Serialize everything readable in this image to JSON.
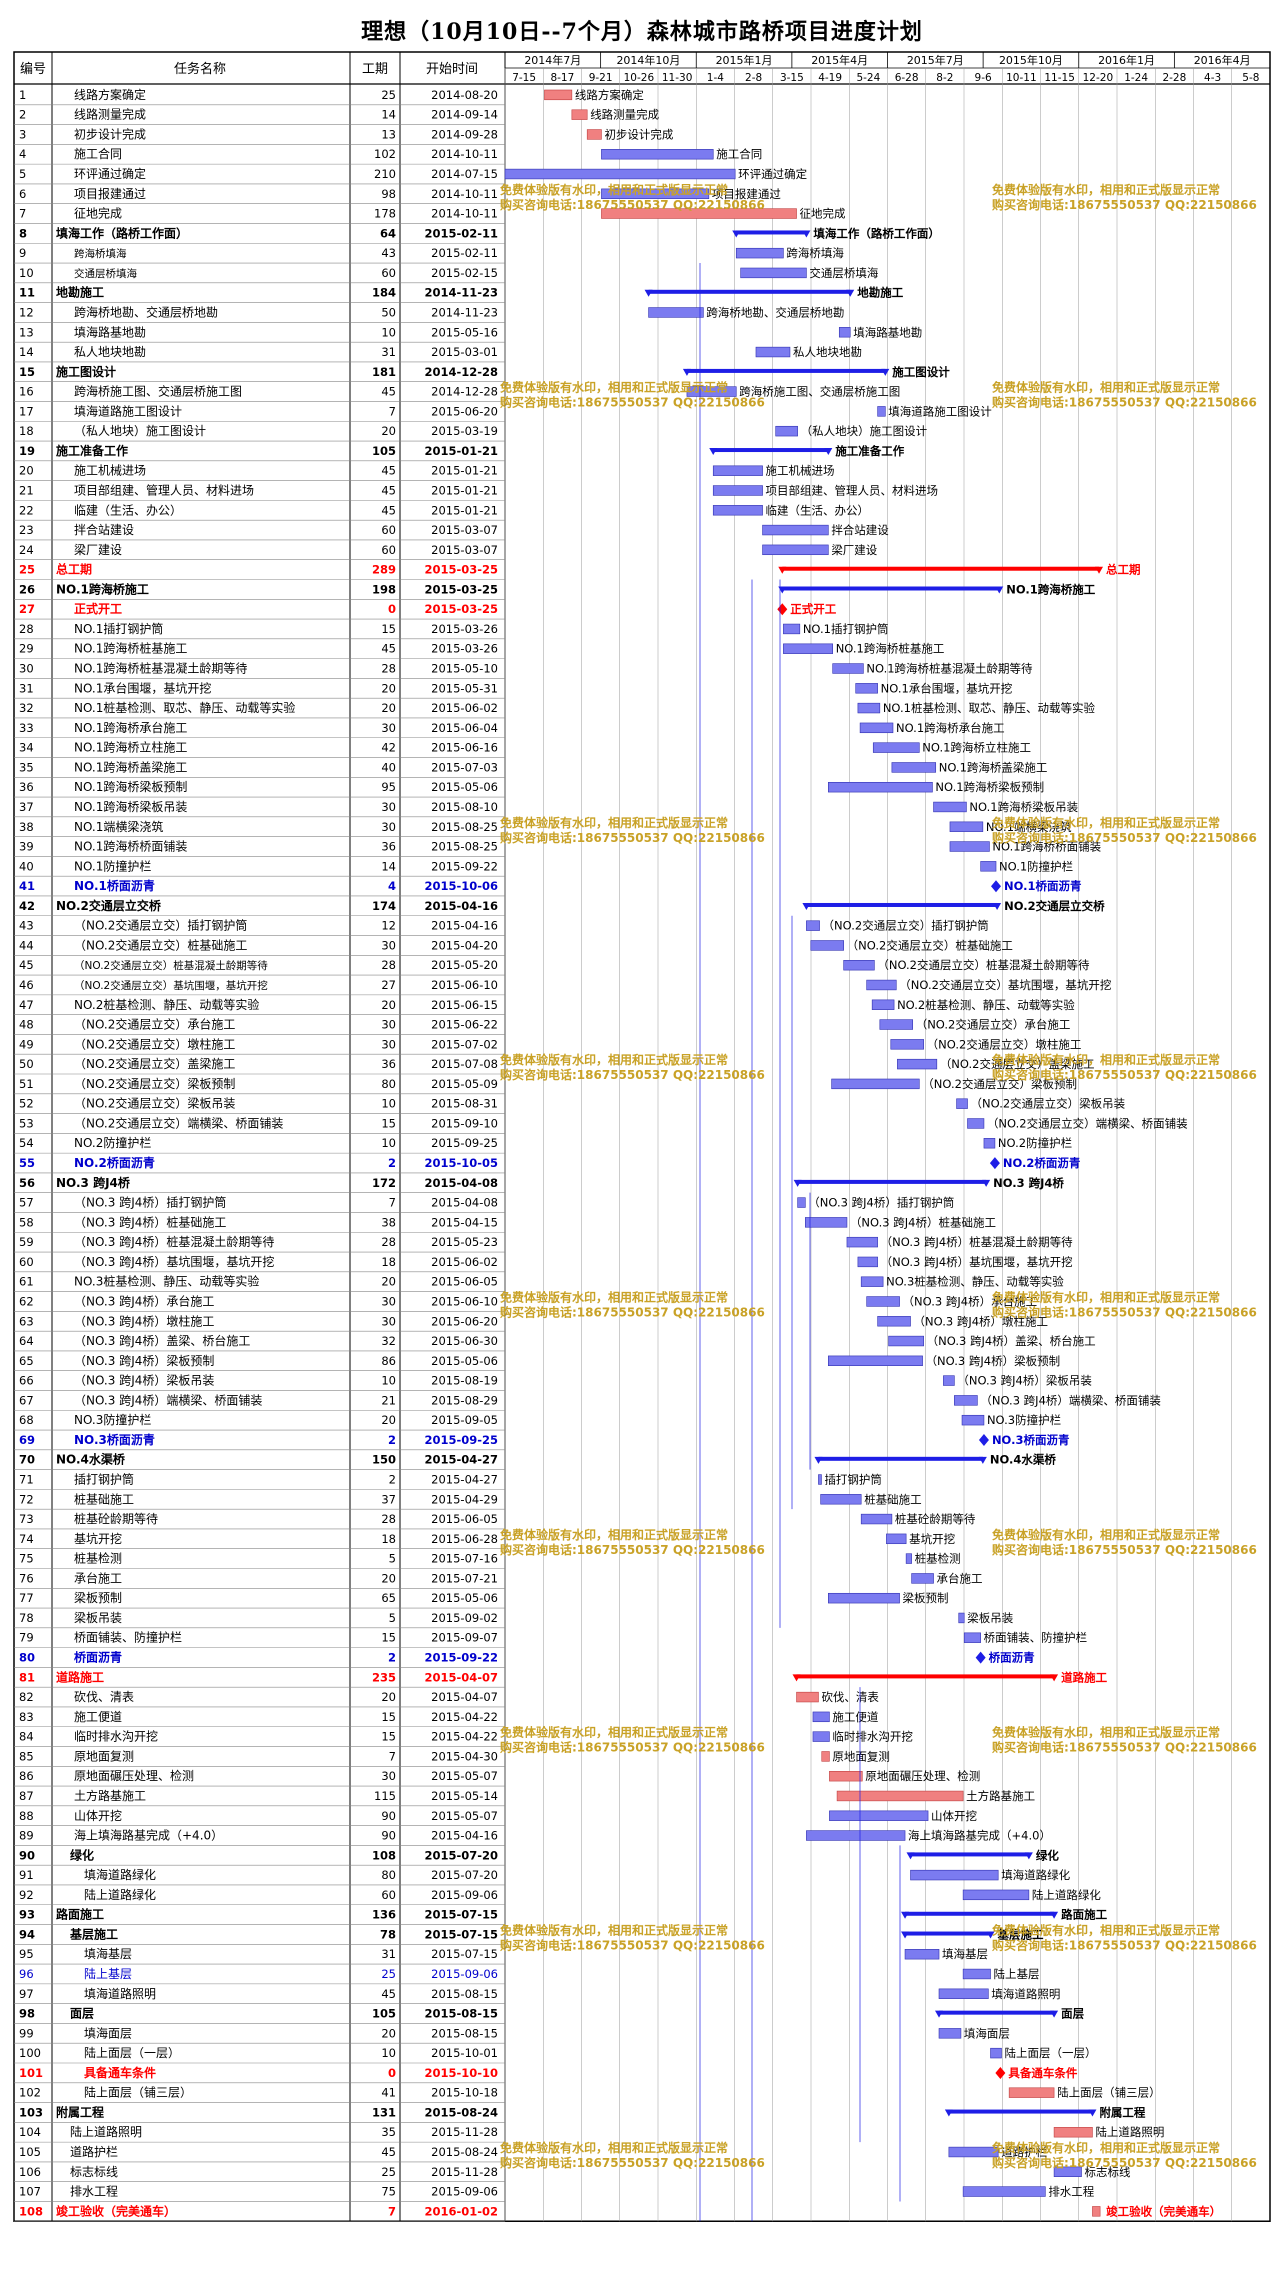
{
  "chart_data": {
    "type": "gantt",
    "title": "理想（10月10日--7个月）森林城市路桥项目进度计划",
    "columns": [
      "编号",
      "任务名称",
      "工期",
      "开始时间"
    ],
    "timeline_top": [
      "2014年7月",
      "2014年10月",
      "2015年1月",
      "2015年4月",
      "2015年7月",
      "2015年10月",
      "2016年1月",
      "2016年4月"
    ],
    "timeline_bottom": [
      "7-15",
      "8-17",
      "9-21",
      "10-26",
      "11-30",
      "1-4",
      "2-8",
      "3-15",
      "4-19",
      "5-24",
      "6-28",
      "8-2",
      "9-6",
      "10-11",
      "11-15",
      "12-20",
      "1-24",
      "2-28",
      "4-3",
      "5-8"
    ],
    "colors": {
      "task_bar": "#7b7bf0",
      "critical_bar": "#f08080",
      "summary": "#1e1ee6",
      "critical_summary": "#ff0000",
      "red_text": "#ff0000",
      "blue_text": "#0000cc",
      "watermark": "#c9a227",
      "grid": "#000000"
    },
    "watermark_lines": [
      "免费体验版有水印，相用和正式版显示正常",
      "购买咨询电话:18675550537 QQ:22150866"
    ],
    "tasks": [
      {
        "id": "1",
        "name": "线路方案确定",
        "dur": "25",
        "start": "2014-08-20",
        "type": "critical"
      },
      {
        "id": "2",
        "name": "线路测量完成",
        "dur": "14",
        "start": "2014-09-14",
        "type": "critical"
      },
      {
        "id": "3",
        "name": "初步设计完成",
        "dur": "13",
        "start": "2014-09-28",
        "type": "critical"
      },
      {
        "id": "4",
        "name": "施工合同",
        "dur": "102",
        "start": "2014-10-11",
        "type": "task"
      },
      {
        "id": "5",
        "name": "环评通过确定",
        "dur": "210",
        "start": "2014-07-15",
        "type": "task"
      },
      {
        "id": "6",
        "name": "项目报建通过",
        "dur": "98",
        "start": "2014-10-11",
        "type": "task"
      },
      {
        "id": "7",
        "name": "征地完成",
        "dur": "178",
        "start": "2014-10-11",
        "type": "critical"
      },
      {
        "id": "8",
        "name": "填海工作（路桥工作面）",
        "dur": "64",
        "start": "2015-02-11",
        "type": "summary"
      },
      {
        "id": "9",
        "name": "跨海桥填海",
        "dur": "43",
        "start": "2015-02-11",
        "type": "task",
        "small": true
      },
      {
        "id": "10",
        "name": "交通层桥填海",
        "dur": "60",
        "start": "2015-02-15",
        "type": "task",
        "small": true
      },
      {
        "id": "11",
        "name": "地勘施工",
        "dur": "184",
        "start": "2014-11-23",
        "type": "summary"
      },
      {
        "id": "12",
        "name": "跨海桥地勘、交通层桥地勘",
        "dur": "50",
        "start": "2014-11-23",
        "type": "task"
      },
      {
        "id": "13",
        "name": "填海路基地勘",
        "dur": "10",
        "start": "2015-05-16",
        "type": "task"
      },
      {
        "id": "14",
        "name": "私人地块地勘",
        "dur": "31",
        "start": "2015-03-01",
        "type": "task"
      },
      {
        "id": "15",
        "name": "施工图设计",
        "dur": "181",
        "start": "2014-12-28",
        "type": "summary"
      },
      {
        "id": "16",
        "name": "跨海桥施工图、交通层桥施工图",
        "dur": "45",
        "start": "2014-12-28",
        "type": "task"
      },
      {
        "id": "17",
        "name": "填海道路施工图设计",
        "dur": "7",
        "start": "2015-06-20",
        "type": "task"
      },
      {
        "id": "18",
        "name": "（私人地块）施工图设计",
        "dur": "20",
        "start": "2015-03-19",
        "type": "task"
      },
      {
        "id": "19",
        "name": "施工准备工作",
        "dur": "105",
        "start": "2015-01-21",
        "type": "summary"
      },
      {
        "id": "20",
        "name": "施工机械进场",
        "dur": "45",
        "start": "2015-01-21",
        "type": "task"
      },
      {
        "id": "21",
        "name": "项目部组建、管理人员、材料进场",
        "dur": "45",
        "start": "2015-01-21",
        "type": "task"
      },
      {
        "id": "22",
        "name": "临建（生活、办公）",
        "dur": "45",
        "start": "2015-01-21",
        "type": "task"
      },
      {
        "id": "23",
        "name": "拌合站建设",
        "dur": "60",
        "start": "2015-03-07",
        "type": "task"
      },
      {
        "id": "24",
        "name": "梁厂建设",
        "dur": "60",
        "start": "2015-03-07",
        "type": "task"
      },
      {
        "id": "25",
        "name": "总工期",
        "dur": "289",
        "start": "2015-03-25",
        "type": "critsummary",
        "label": "总工期"
      },
      {
        "id": "26",
        "name": "NO.1跨海桥施工",
        "dur": "198",
        "start": "2015-03-25",
        "type": "summary"
      },
      {
        "id": "27",
        "name": "正式开工",
        "dur": "0",
        "start": "2015-03-25",
        "type": "critmilestone"
      },
      {
        "id": "28",
        "name": "NO.1插打钢护筒",
        "dur": "15",
        "start": "2015-03-26",
        "type": "task"
      },
      {
        "id": "29",
        "name": "NO.1跨海桥桩基施工",
        "dur": "45",
        "start": "2015-03-26",
        "type": "task"
      },
      {
        "id": "30",
        "name": "NO.1跨海桥桩基混凝土龄期等待",
        "dur": "28",
        "start": "2015-05-10",
        "type": "task"
      },
      {
        "id": "31",
        "name": "NO.1承台围堰，基坑开挖",
        "dur": "20",
        "start": "2015-05-31",
        "type": "task"
      },
      {
        "id": "32",
        "name": "NO.1桩基检测、取芯、静压、动载等实验",
        "dur": "20",
        "start": "2015-06-02",
        "type": "task"
      },
      {
        "id": "33",
        "name": "NO.1跨海桥承台施工",
        "dur": "30",
        "start": "2015-06-04",
        "type": "task"
      },
      {
        "id": "34",
        "name": "NO.1跨海桥立柱施工",
        "dur": "42",
        "start": "2015-06-16",
        "type": "task"
      },
      {
        "id": "35",
        "name": "NO.1跨海桥盖梁施工",
        "dur": "40",
        "start": "2015-07-03",
        "type": "task"
      },
      {
        "id": "36",
        "name": "NO.1跨海桥梁板预制",
        "dur": "95",
        "start": "2015-05-06",
        "type": "task"
      },
      {
        "id": "37",
        "name": "NO.1跨海桥梁板吊装",
        "dur": "30",
        "start": "2015-08-10",
        "type": "task"
      },
      {
        "id": "38",
        "name": "NO.1端横梁浇筑",
        "dur": "30",
        "start": "2015-08-25",
        "type": "task"
      },
      {
        "id": "39",
        "name": "NO.1跨海桥桥面铺装",
        "dur": "36",
        "start": "2015-08-25",
        "type": "task"
      },
      {
        "id": "40",
        "name": "NO.1防撞护栏",
        "dur": "14",
        "start": "2015-09-22",
        "type": "task"
      },
      {
        "id": "41",
        "name": "NO.1桥面沥青",
        "dur": "4",
        "start": "2015-10-06",
        "type": "bluemilestone"
      },
      {
        "id": "42",
        "name": "NO.2交通层立交桥",
        "dur": "174",
        "start": "2015-04-16",
        "type": "summary"
      },
      {
        "id": "43",
        "name": "（NO.2交通层立交）插打钢护筒",
        "dur": "12",
        "start": "2015-04-16",
        "type": "task"
      },
      {
        "id": "44",
        "name": "（NO.2交通层立交）桩基础施工",
        "dur": "30",
        "start": "2015-04-20",
        "type": "task"
      },
      {
        "id": "45",
        "name": "（NO.2交通层立交）桩基混凝土龄期等待",
        "dur": "28",
        "start": "2015-05-20",
        "type": "task",
        "small": true
      },
      {
        "id": "46",
        "name": "（NO.2交通层立交）基坑围堰，基坑开挖",
        "dur": "27",
        "start": "2015-06-10",
        "type": "task",
        "small": true
      },
      {
        "id": "47",
        "name": "NO.2桩基检测、静压、动载等实验",
        "dur": "20",
        "start": "2015-06-15",
        "type": "task"
      },
      {
        "id": "48",
        "name": "（NO.2交通层立交）承台施工",
        "dur": "30",
        "start": "2015-06-22",
        "type": "task"
      },
      {
        "id": "49",
        "name": "（NO.2交通层立交）墩柱施工",
        "dur": "30",
        "start": "2015-07-02",
        "type": "task"
      },
      {
        "id": "50",
        "name": "（NO.2交通层立交）盖梁施工",
        "dur": "36",
        "start": "2015-07-08",
        "type": "task"
      },
      {
        "id": "51",
        "name": "（NO.2交通层立交）梁板预制",
        "dur": "80",
        "start": "2015-05-09",
        "type": "task"
      },
      {
        "id": "52",
        "name": "（NO.2交通层立交）梁板吊装",
        "dur": "10",
        "start": "2015-08-31",
        "type": "task"
      },
      {
        "id": "53",
        "name": "（NO.2交通层立交）端横梁、桥面铺装",
        "dur": "15",
        "start": "2015-09-10",
        "type": "task"
      },
      {
        "id": "54",
        "name": "NO.2防撞护栏",
        "dur": "10",
        "start": "2015-09-25",
        "type": "task"
      },
      {
        "id": "55",
        "name": "NO.2桥面沥青",
        "dur": "2",
        "start": "2015-10-05",
        "type": "bluemilestone"
      },
      {
        "id": "56",
        "name": "NO.3 跨J4桥",
        "dur": "172",
        "start": "2015-04-08",
        "type": "summary"
      },
      {
        "id": "57",
        "name": "（NO.3 跨J4桥）插打钢护筒",
        "dur": "7",
        "start": "2015-04-08",
        "type": "task"
      },
      {
        "id": "58",
        "name": "（NO.3 跨J4桥）桩基础施工",
        "dur": "38",
        "start": "2015-04-15",
        "type": "task"
      },
      {
        "id": "59",
        "name": "（NO.3 跨J4桥）桩基混凝土龄期等待",
        "dur": "28",
        "start": "2015-05-23",
        "type": "task"
      },
      {
        "id": "60",
        "name": "（NO.3 跨J4桥）基坑围堰，基坑开挖",
        "dur": "18",
        "start": "2015-06-02",
        "type": "task"
      },
      {
        "id": "61",
        "name": "NO.3桩基检测、静压、动载等实验",
        "dur": "20",
        "start": "2015-06-05",
        "type": "task"
      },
      {
        "id": "62",
        "name": "（NO.3 跨J4桥）承台施工",
        "dur": "30",
        "start": "2015-06-10",
        "type": "task"
      },
      {
        "id": "63",
        "name": "（NO.3 跨J4桥）墩柱施工",
        "dur": "30",
        "start": "2015-06-20",
        "type": "task"
      },
      {
        "id": "64",
        "name": "（NO.3 跨J4桥）盖梁、桥台施工",
        "dur": "32",
        "start": "2015-06-30",
        "type": "task"
      },
      {
        "id": "65",
        "name": "（NO.3 跨J4桥）梁板预制",
        "dur": "86",
        "start": "2015-05-06",
        "type": "task"
      },
      {
        "id": "66",
        "name": "（NO.3 跨J4桥）梁板吊装",
        "dur": "10",
        "start": "2015-08-19",
        "type": "task"
      },
      {
        "id": "67",
        "name": "（NO.3 跨J4桥）端横梁、桥面铺装",
        "dur": "21",
        "start": "2015-08-29",
        "type": "task"
      },
      {
        "id": "68",
        "name": "NO.3防撞护栏",
        "dur": "20",
        "start": "2015-09-05",
        "type": "task"
      },
      {
        "id": "69",
        "name": "NO.3桥面沥青",
        "dur": "2",
        "start": "2015-09-25",
        "type": "bluemilestone"
      },
      {
        "id": "70",
        "name": "NO.4水渠桥",
        "dur": "150",
        "start": "2015-04-27",
        "type": "summary"
      },
      {
        "id": "71",
        "name": "插打钢护筒",
        "dur": "2",
        "start": "2015-04-27",
        "type": "task"
      },
      {
        "id": "72",
        "name": "桩基础施工",
        "dur": "37",
        "start": "2015-04-29",
        "type": "task"
      },
      {
        "id": "73",
        "name": "桩基砼龄期等待",
        "dur": "28",
        "start": "2015-06-05",
        "type": "task"
      },
      {
        "id": "74",
        "name": "基坑开挖",
        "dur": "18",
        "start": "2015-06-28",
        "type": "task"
      },
      {
        "id": "75",
        "name": "桩基检测",
        "dur": "5",
        "start": "2015-07-16",
        "type": "task"
      },
      {
        "id": "76",
        "name": "承台施工",
        "dur": "20",
        "start": "2015-07-21",
        "type": "task"
      },
      {
        "id": "77",
        "name": "梁板预制",
        "dur": "65",
        "start": "2015-05-06",
        "type": "task"
      },
      {
        "id": "78",
        "name": "梁板吊装",
        "dur": "5",
        "start": "2015-09-02",
        "type": "task"
      },
      {
        "id": "79",
        "name": "桥面铺装、防撞护栏",
        "dur": "15",
        "start": "2015-09-07",
        "type": "task"
      },
      {
        "id": "80",
        "name": "桥面沥青",
        "dur": "2",
        "start": "2015-09-22",
        "type": "bluemilestone"
      },
      {
        "id": "81",
        "name": "道路施工",
        "dur": "235",
        "start": "2015-04-07",
        "type": "critsummary",
        "label": "道路施工"
      },
      {
        "id": "82",
        "name": "砍伐、清表",
        "dur": "20",
        "start": "2015-04-07",
        "type": "critical"
      },
      {
        "id": "83",
        "name": "施工便道",
        "dur": "15",
        "start": "2015-04-22",
        "type": "task"
      },
      {
        "id": "84",
        "name": "临时排水沟开挖",
        "dur": "15",
        "start": "2015-04-22",
        "type": "task"
      },
      {
        "id": "85",
        "name": "原地面复测",
        "dur": "7",
        "start": "2015-04-30",
        "type": "critical"
      },
      {
        "id": "86",
        "name": "原地面碾压处理、检测",
        "dur": "30",
        "start": "2015-05-07",
        "type": "critical"
      },
      {
        "id": "87",
        "name": "土方路基施工",
        "dur": "115",
        "start": "2015-05-14",
        "type": "critical"
      },
      {
        "id": "88",
        "name": "山体开挖",
        "dur": "90",
        "start": "2015-05-07",
        "type": "task"
      },
      {
        "id": "89",
        "name": "海上填海路基完成（+4.0）",
        "dur": "90",
        "start": "2015-04-16",
        "type": "task"
      },
      {
        "id": "90",
        "name": "绿化",
        "dur": "108",
        "start": "2015-07-20",
        "type": "summary",
        "indent": 1
      },
      {
        "id": "91",
        "name": "填海道路绿化",
        "dur": "80",
        "start": "2015-07-20",
        "type": "task",
        "indent": 2
      },
      {
        "id": "92",
        "name": "陆上道路绿化",
        "dur": "60",
        "start": "2015-09-06",
        "type": "task",
        "indent": 2
      },
      {
        "id": "93",
        "name": "路面施工",
        "dur": "136",
        "start": "2015-07-15",
        "type": "summary"
      },
      {
        "id": "94",
        "name": "基层施工",
        "dur": "78",
        "start": "2015-07-15",
        "type": "summary",
        "indent": 1
      },
      {
        "id": "95",
        "name": "填海基层",
        "dur": "31",
        "start": "2015-07-15",
        "type": "task",
        "indent": 2
      },
      {
        "id": "96",
        "name": "陆上基层",
        "dur": "25",
        "start": "2015-09-06",
        "type": "task",
        "indent": 2,
        "color": "blue"
      },
      {
        "id": "97",
        "name": "填海道路照明",
        "dur": "45",
        "start": "2015-08-15",
        "type": "task",
        "indent": 2
      },
      {
        "id": "98",
        "name": "面层",
        "dur": "105",
        "start": "2015-08-15",
        "type": "summary",
        "indent": 1
      },
      {
        "id": "99",
        "name": "填海面层",
        "dur": "20",
        "start": "2015-08-15",
        "type": "task",
        "indent": 2
      },
      {
        "id": "100",
        "name": "陆上面层（一层）",
        "dur": "10",
        "start": "2015-10-01",
        "type": "task",
        "indent": 2
      },
      {
        "id": "101",
        "name": "具备通车条件",
        "dur": "0",
        "start": "2015-10-10",
        "type": "critmilestone",
        "indent": 2
      },
      {
        "id": "102",
        "name": "陆上面层（铺三层）",
        "dur": "41",
        "start": "2015-10-18",
        "type": "critical",
        "indent": 2
      },
      {
        "id": "103",
        "name": "附属工程",
        "dur": "131",
        "start": "2015-08-24",
        "type": "summary"
      },
      {
        "id": "104",
        "name": "陆上道路照明",
        "dur": "35",
        "start": "2015-11-28",
        "type": "critical",
        "indent": 1
      },
      {
        "id": "105",
        "name": "道路护栏",
        "dur": "45",
        "start": "2015-08-24",
        "type": "task",
        "indent": 1
      },
      {
        "id": "106",
        "name": "标志标线",
        "dur": "25",
        "start": "2015-11-28",
        "type": "task",
        "indent": 1
      },
      {
        "id": "107",
        "name": "排水工程",
        "dur": "75",
        "start": "2015-09-06",
        "type": "task",
        "indent": 1
      },
      {
        "id": "108",
        "name": "竣工验收（完美通车）",
        "dur": "7",
        "start": "2016-01-02",
        "type": "final"
      }
    ]
  }
}
